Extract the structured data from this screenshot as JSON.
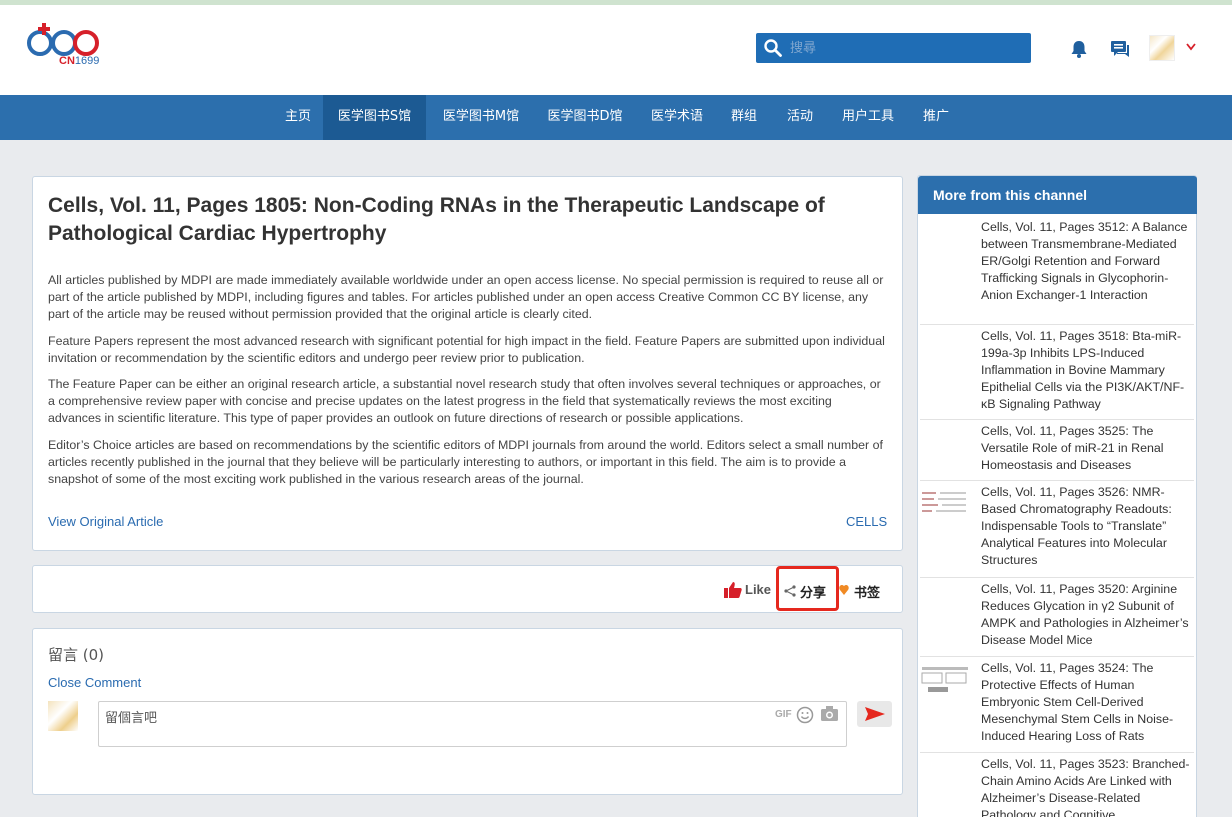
{
  "logo": {
    "brand": "CN",
    "brand_num": "1699"
  },
  "search": {
    "placeholder": "搜尋"
  },
  "nav": {
    "items": [
      "主页",
      "医学图书S馆",
      "医学图书M馆",
      "医学图书D馆",
      "医学术语",
      "群组",
      "活动",
      "用户工具",
      "推广"
    ],
    "active": "医学图书S馆"
  },
  "article": {
    "title": "Cells, Vol. 11, Pages 1805: Non-Coding RNAs in the Therapeutic Landscape of Pathological Cardiac Hypertrophy",
    "paragraphs": [
      "All articles published by MDPI are made immediately available worldwide under an open access license. No special permission is required to reuse all or part of the article published by MDPI, including figures and tables. For articles published under an open access Creative Common CC BY license, any part of the article may be reused without permission provided that the original article is clearly cited.",
      "Feature Papers represent the most advanced research with significant potential for high impact in the field. Feature Papers are submitted upon individual invitation or recommendation by the scientific editors and undergo peer review prior to publication.",
      "The Feature Paper can be either an original research article, a substantial novel research study that often involves several techniques or approaches, or a comprehensive review paper with concise and precise updates on the latest progress in the field that systematically reviews the most exciting advances in scientific literature. This type of paper provides an outlook on future directions of research or possible applications.",
      "Editor’s Choice articles are based on recommendations by the scientific editors of MDPI journals from around the world. Editors select a small number of articles recently published in the journal that they believe will be particularly interesting to authors, or important in this field. The aim is to provide a snapshot of some of the most exciting work published in the various research areas of the journal."
    ],
    "view_original": "View Original Article",
    "channel_link": "CELLS"
  },
  "actions": {
    "like": "Like",
    "share": "分享",
    "bookmark": "书签"
  },
  "comments": {
    "title": "留言 (0)",
    "close": "Close Comment",
    "placeholder": "留個言吧",
    "gif": "GIF"
  },
  "sidebar": {
    "title": "More from this channel",
    "items": [
      "Cells, Vol. 11, Pages 3512: A Balance between Transmembrane-Mediated ER/Golgi Retention and Forward Trafficking Signals in Glycophorin-Anion Exchanger-1 Interaction",
      "Cells, Vol. 11, Pages 3518: Bta-miR-199a-3p Inhibits LPS-Induced Inflammation in Bovine Mammary Epithelial Cells via the PI3K/AKT/NF-κB Signaling Pathway",
      "Cells, Vol. 11, Pages 3525: The Versatile Role of miR-21 in Renal Homeostasis and Diseases",
      "Cells, Vol. 11, Pages 3526: NMR-Based Chromatography Readouts: Indispensable Tools to “Translate” Analytical Features into Molecular Structures",
      "Cells, Vol. 11, Pages 3520: Arginine Reduces Glycation in γ2 Subunit of AMPK and Pathologies in Alzheimer’s Disease Model Mice",
      "Cells, Vol. 11, Pages 3524: The Protective Effects of Human Embryonic Stem Cell-Derived Mesenchymal Stem Cells in Noise-Induced Hearing Loss of Rats",
      "Cells, Vol. 11, Pages 3523: Branched-Chain Amino Acids Are Linked with Alzheimer’s Disease-Related Pathology and Cognitive"
    ]
  },
  "colors": {
    "nav": "#2c6fad",
    "nav_active": "#1c5a93",
    "link": "#2a6bb0",
    "highlight": "#e5281e"
  }
}
